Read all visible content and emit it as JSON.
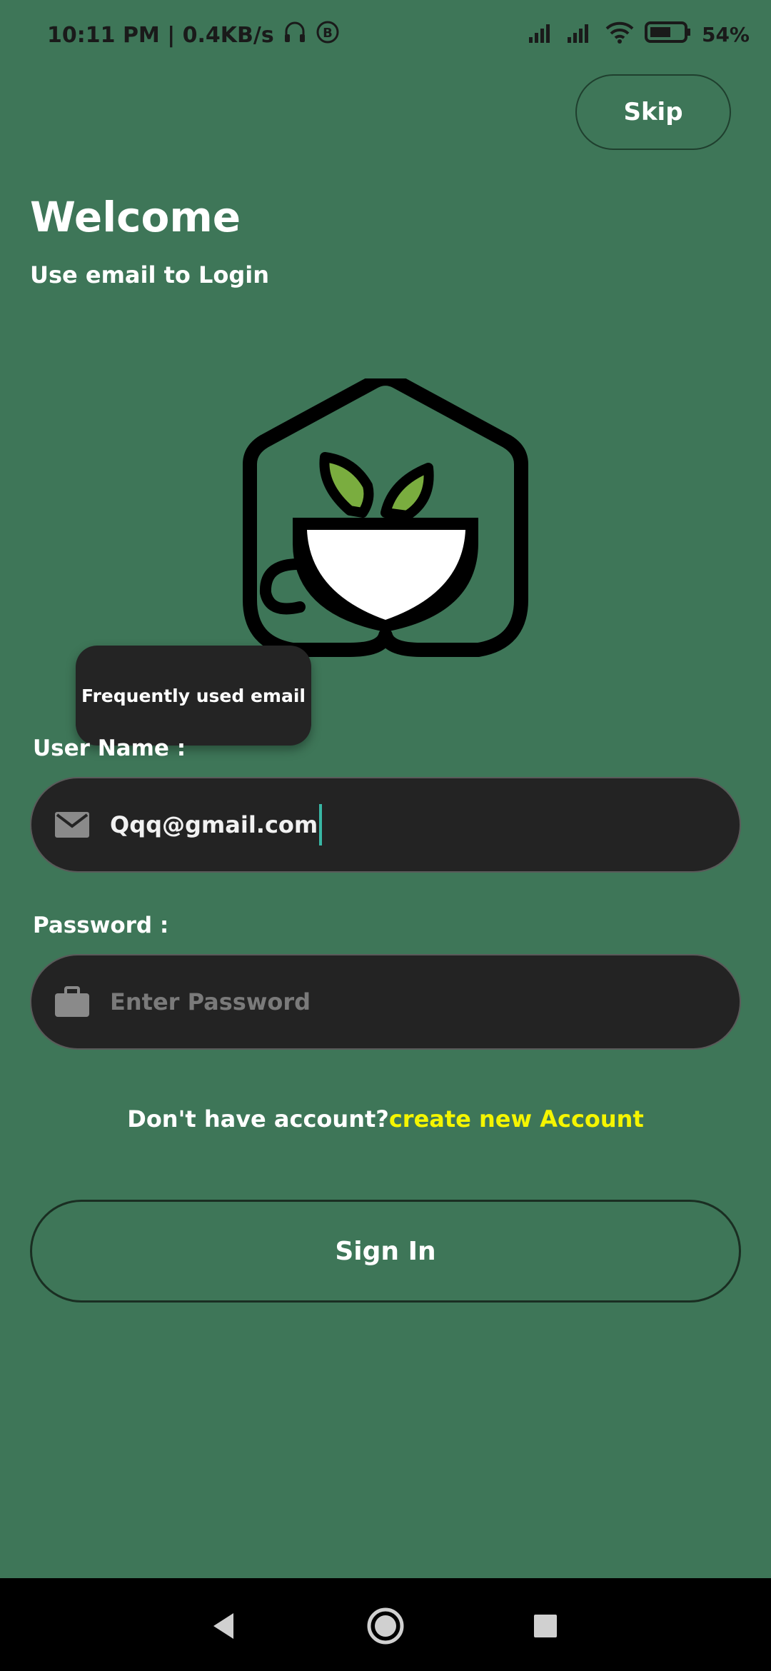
{
  "status_bar": {
    "time_info": "10:11 PM | 0.4KB/s",
    "battery": "54%"
  },
  "skip_label": "Skip",
  "welcome_title": "Welcome",
  "welcome_subtitle": "Use email to Login",
  "tooltip_text": "Frequently used email",
  "username": {
    "label": "User Name :",
    "value": "Qqq@gmail.com",
    "icon": "mail-icon"
  },
  "password": {
    "label": "Password :",
    "placeholder": "Enter Password",
    "icon": "briefcase-icon"
  },
  "signup": {
    "prompt": "Don't have account?",
    "link": "create new Account"
  },
  "signin_label": "Sign In",
  "colors": {
    "background": "#3e7658",
    "field_bg": "#232323",
    "link": "#f5f500",
    "leaf": "#7aad3f"
  }
}
